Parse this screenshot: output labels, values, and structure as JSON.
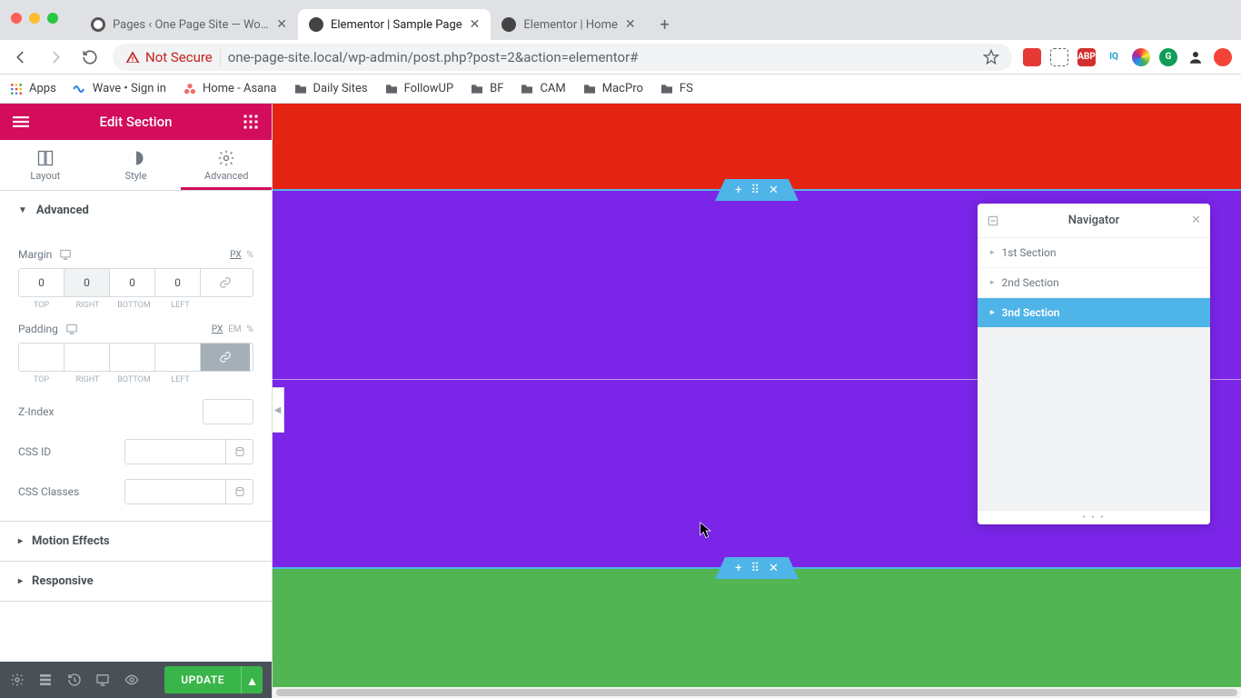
{
  "browser": {
    "tabs": [
      {
        "title": "Pages ‹ One Page Site — Word",
        "active": false
      },
      {
        "title": "Elementor | Sample Page",
        "active": true
      },
      {
        "title": "Elementor | Home",
        "active": false
      }
    ],
    "not_secure": "Not Secure",
    "url": "one-page-site.local/wp-admin/post.php?post=2&action=elementor#",
    "bookmarks": {
      "apps": "Apps",
      "items": [
        "Wave • Sign in",
        "Home - Asana",
        "Daily Sites",
        "FollowUP",
        "BF",
        "CAM",
        "MacPro",
        "FS"
      ]
    }
  },
  "panel": {
    "title": "Edit Section",
    "tabs": {
      "layout": "Layout",
      "style": "Style",
      "advanced": "Advanced"
    },
    "sections": {
      "advanced": {
        "title": "Advanced",
        "margin": {
          "label": "Margin",
          "units": [
            "PX",
            "%"
          ],
          "active_unit": "PX",
          "top": "0",
          "right": "0",
          "bottom": "0",
          "left": "0",
          "sub": [
            "TOP",
            "RIGHT",
            "BOTTOM",
            "LEFT"
          ]
        },
        "padding": {
          "label": "Padding",
          "units": [
            "PX",
            "EM",
            "%"
          ],
          "active_unit": "PX",
          "top": "",
          "right": "",
          "bottom": "",
          "left": "",
          "sub": [
            "TOP",
            "RIGHT",
            "BOTTOM",
            "LEFT"
          ]
        },
        "zindex": {
          "label": "Z-Index",
          "value": ""
        },
        "cssid": {
          "label": "CSS ID",
          "value": ""
        },
        "cssclasses": {
          "label": "CSS Classes",
          "value": ""
        }
      },
      "motion": "Motion Effects",
      "responsive": "Responsive"
    },
    "footer": {
      "update": "UPDATE"
    }
  },
  "navigator": {
    "title": "Navigator",
    "items": [
      {
        "label": "1st Section",
        "active": false
      },
      {
        "label": "2nd Section",
        "active": false
      },
      {
        "label": "3nd Section",
        "active": true
      }
    ]
  },
  "colors": {
    "red": "#e42312",
    "purple": "#7a25e8",
    "green": "#52b553",
    "handle": "#4fb4e8",
    "brand": "#d30c5c"
  }
}
